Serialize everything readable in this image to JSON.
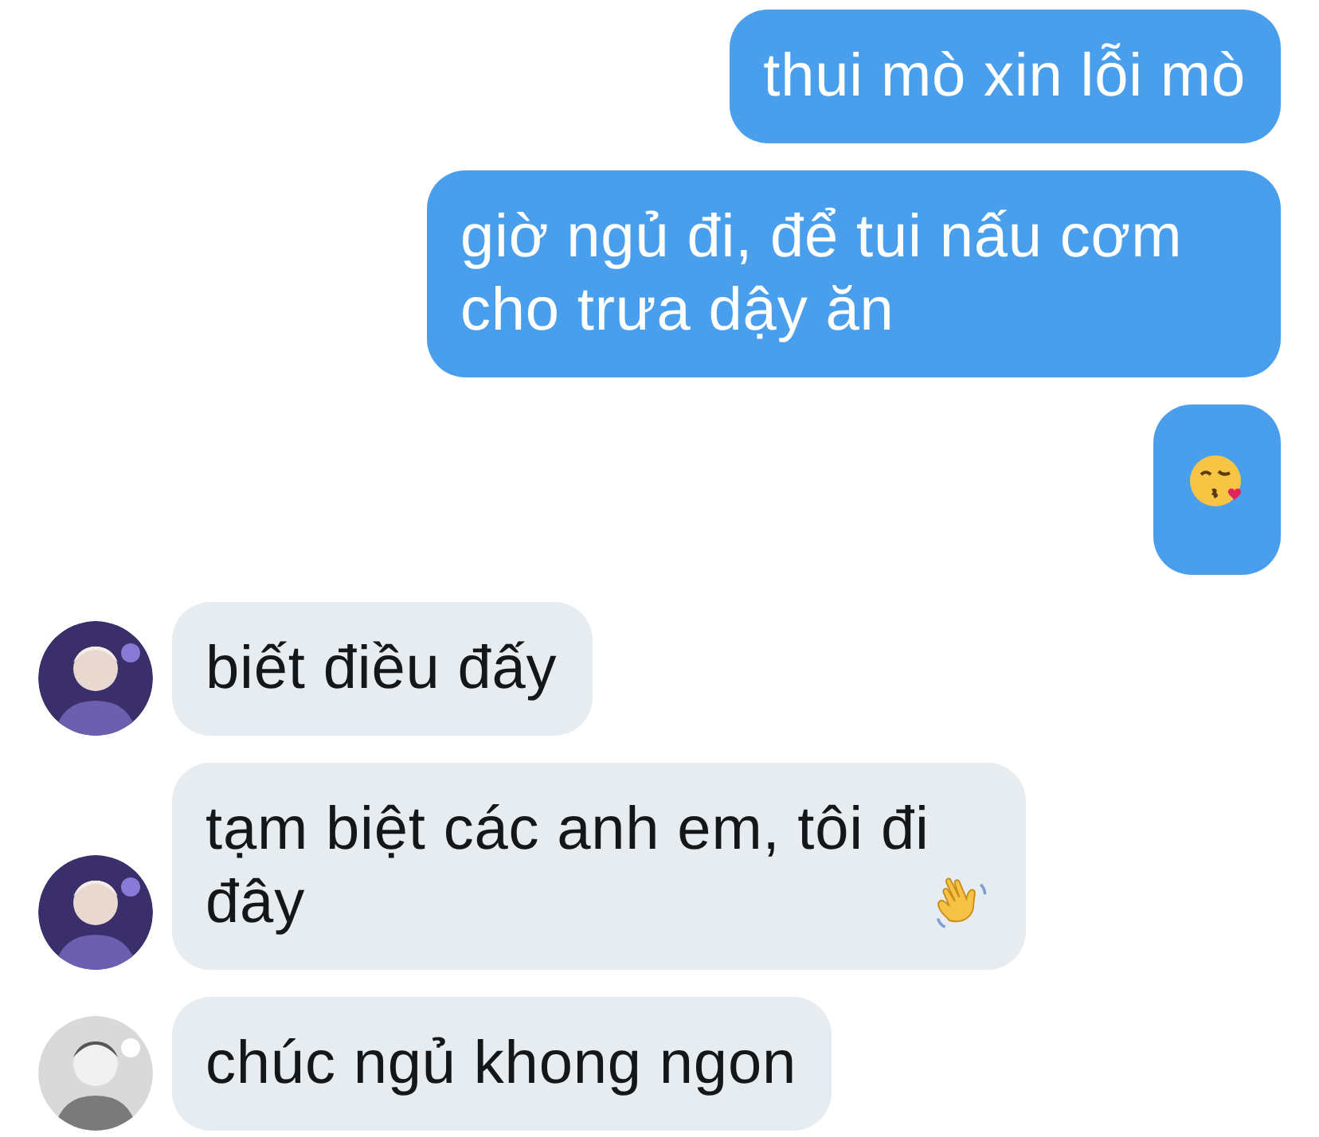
{
  "messages": [
    {
      "sent": true,
      "kind": "text",
      "text": "thui mò xin lỗi mò"
    },
    {
      "sent": true,
      "kind": "text",
      "text": "giờ ngủ đi, để tui nấu cơm cho trưa dậy ăn"
    },
    {
      "sent": true,
      "kind": "kiss"
    },
    {
      "sent": false,
      "kind": "text",
      "text": "biết điều đấy"
    },
    {
      "sent": false,
      "kind": "waving",
      "text": "tạm biệt các anh em, tôi đi đây"
    },
    {
      "sent": false,
      "kind": "text",
      "text": "chúc ngủ khong ngon"
    }
  ]
}
